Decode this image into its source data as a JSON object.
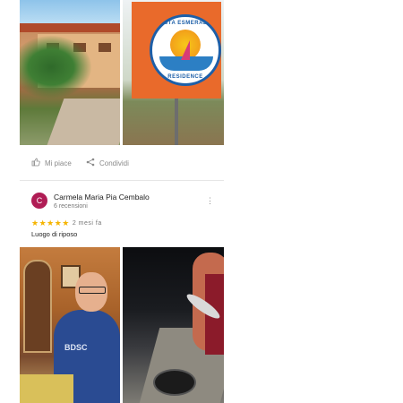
{
  "post": {
    "photos_top": [
      {
        "alt": "residence-building-photo"
      },
      {
        "alt": "costa-esmeralda-sign-photo",
        "sign_text_top": "COSTA ESMERALDA",
        "sign_text_bottom": "RESIDENCE"
      }
    ],
    "actions": {
      "like_label": "Mi piace",
      "share_label": "Condividi",
      "like_icon": "thumb-up-icon",
      "share_icon": "share-icon"
    }
  },
  "review": {
    "avatar_letter": "C",
    "avatar_color": "#b01d55",
    "author": "Carmela Maria Pia Cembalo",
    "review_count": "6 recensioni",
    "rating": 5,
    "stars": "★★★★★",
    "time": "2 mesi fa",
    "text": "Luogo di riposo",
    "more_icon": "more-vertical-icon",
    "photo_shirt_text": "BDSC",
    "photos": [
      {
        "alt": "man-at-table-photo"
      },
      {
        "alt": "fishing-at-dock-photo"
      }
    ]
  },
  "colors": {
    "star": "#f5b400",
    "muted_text": "#8a8a8a",
    "sign_orange": "#e96a2b"
  }
}
